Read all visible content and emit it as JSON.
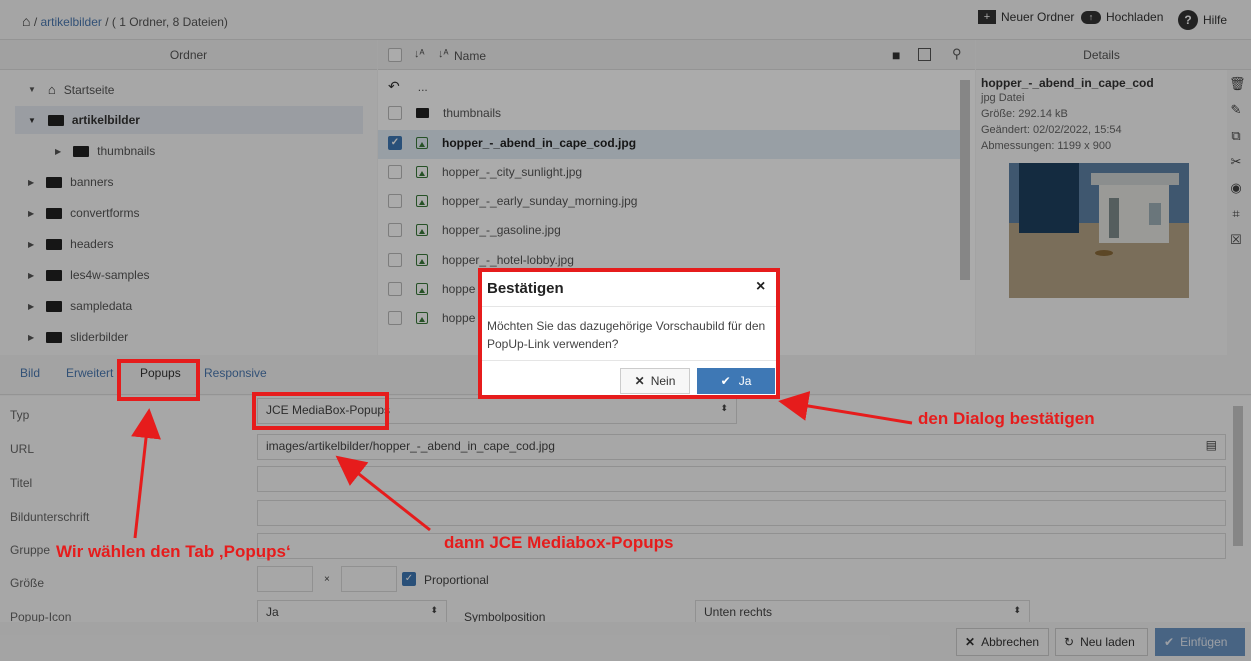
{
  "breadcrumb": {
    "sep": "/",
    "folder": "artikelbilder",
    "info": "/ ( 1 Ordner, 8 Dateien)"
  },
  "toolbar": {
    "new_folder": "Neuer Ordner",
    "upload": "Hochladen",
    "help": "Hilfe"
  },
  "tree": {
    "header": "Ordner",
    "items": [
      {
        "label": "Startseite",
        "icon": "home-icon"
      },
      {
        "label": "artikelbilder",
        "icon": "folder-open-icon"
      },
      {
        "label": "thumbnails",
        "icon": "folder-icon"
      },
      {
        "label": "banners",
        "icon": "folder-icon"
      },
      {
        "label": "convertforms",
        "icon": "folder-icon"
      },
      {
        "label": "headers",
        "icon": "folder-icon"
      },
      {
        "label": "les4w-samples",
        "icon": "folder-icon"
      },
      {
        "label": "sampledata",
        "icon": "folder-icon"
      },
      {
        "label": "sliderbilder",
        "icon": "folder-icon"
      }
    ]
  },
  "files": {
    "header": "Name",
    "up": "...",
    "items": [
      {
        "name": "thumbnails"
      },
      {
        "name": "hopper_-_abend_in_cape_cod.jpg"
      },
      {
        "name": "hopper_-_city_sunlight.jpg"
      },
      {
        "name": "hopper_-_early_sunday_morning.jpg"
      },
      {
        "name": "hopper_-_gasoline.jpg"
      },
      {
        "name": "hopper_-_hotel-lobby.jpg"
      },
      {
        "name": "hoppe"
      },
      {
        "name": "hoppe"
      }
    ]
  },
  "details": {
    "header": "Details",
    "name": "hopper_-_abend_in_cape_cod",
    "type": "jpg Datei",
    "size": "Größe: 292.14 kB",
    "modified": "Geändert: 02/02/2022, 15:54",
    "dims": "Abmessungen: 1199 x 900"
  },
  "tabs": {
    "bild": "Bild",
    "erweitert": "Erweitert",
    "popups": "Popups",
    "responsive": "Responsive"
  },
  "form": {
    "typ_label": "Typ",
    "typ_value": "JCE MediaBox-Popups",
    "url_label": "URL",
    "url_value": "images/artikelbilder/hopper_-_abend_in_cape_cod.jpg",
    "titel_label": "Titel",
    "caption_label": "Bildunterschrift",
    "gruppe_label": "Gruppe",
    "groesse_label": "Größe",
    "x": "×",
    "proportional": "Proportional",
    "icon_label": "Popup-Icon",
    "icon_value": "Ja",
    "symbol_label": "Symbolposition",
    "symbol_value": "Unten rechts"
  },
  "dialog": {
    "title": "Bestätigen",
    "close": "×",
    "message": "Möchten Sie das dazugehörige Vorschaubild für den PopUp-Link verwenden?",
    "no": "Nein",
    "yes": "Ja"
  },
  "buttons": {
    "cancel": "Abbrechen",
    "reload": "Neu laden",
    "insert": "Einfügen"
  },
  "annotations": {
    "dialog": "den Dialog bestätigen",
    "mediabox": "dann JCE Mediabox-Popups",
    "tab": "Wir wählen den Tab ‚Popups‘"
  },
  "colors": {
    "accent": "#3e78b5",
    "highlight": "#e61c1c",
    "selected_row": "#e3edf7"
  }
}
